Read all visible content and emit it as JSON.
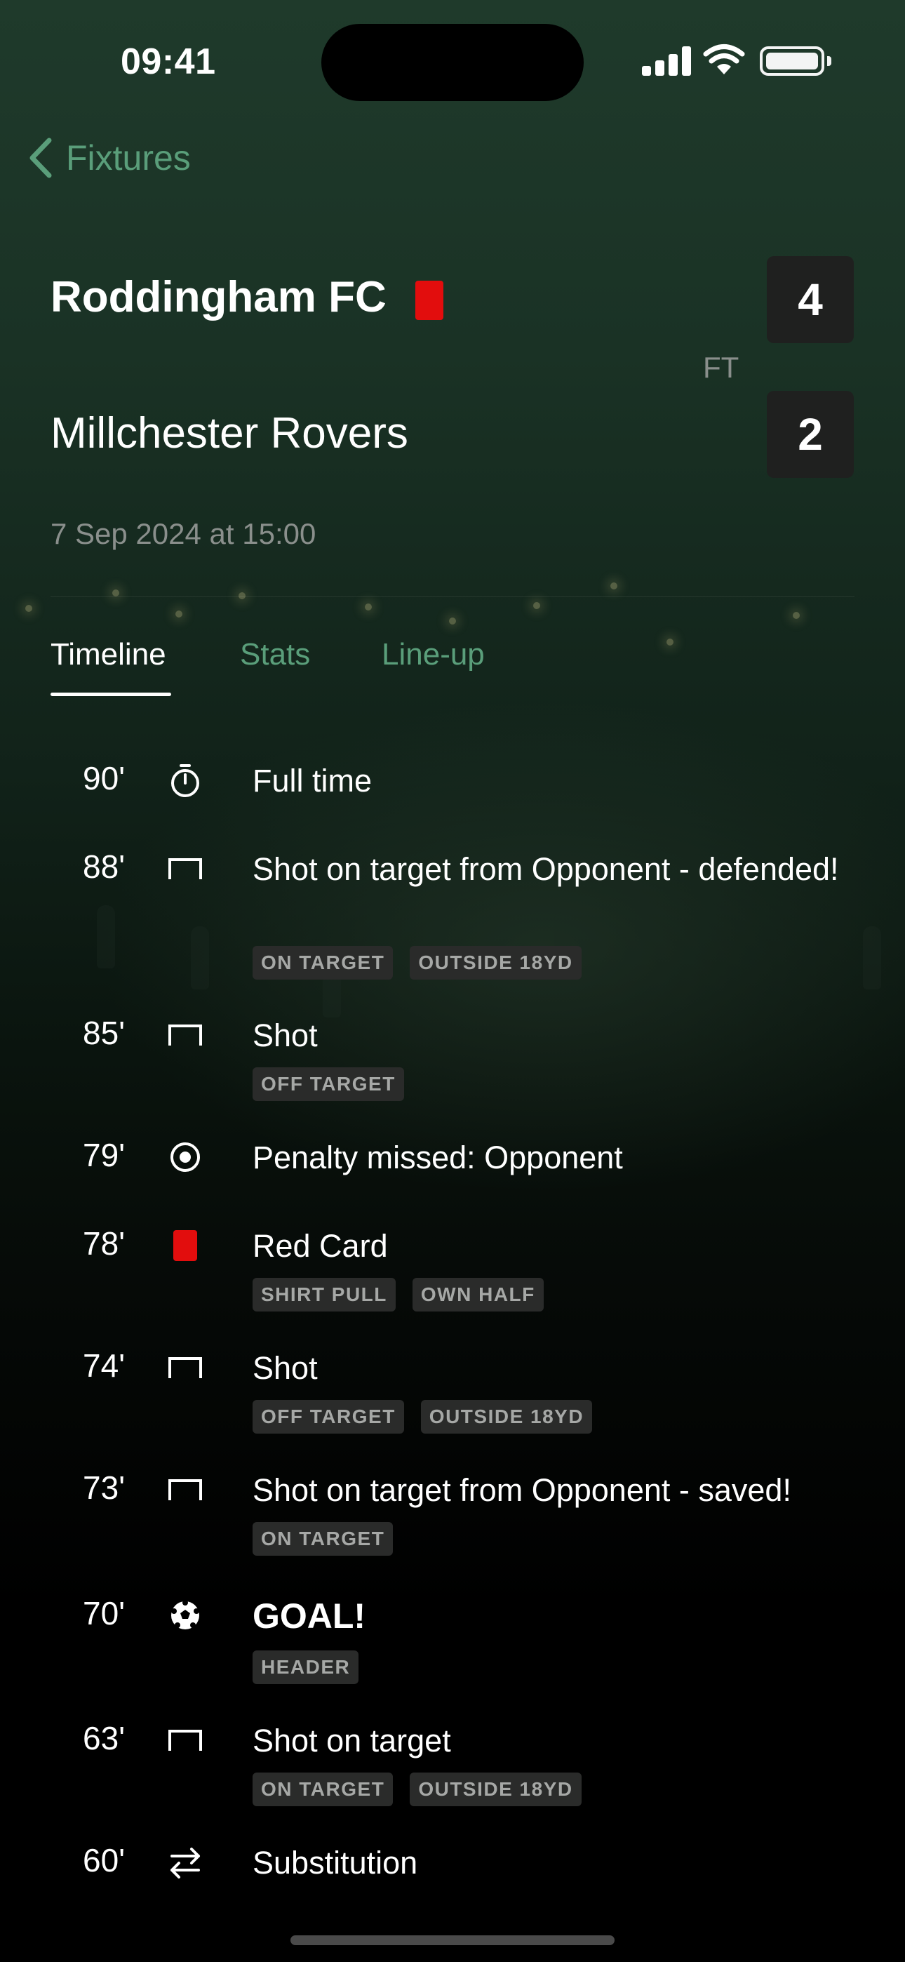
{
  "status_bar": {
    "time": "09:41"
  },
  "nav": {
    "back_label": "Fixtures"
  },
  "match": {
    "home_team": "Roddingham FC",
    "away_team": "Millchester Rovers",
    "home_score": "4",
    "away_score": "2",
    "status": "FT",
    "kickoff": "7 Sep 2024 at 15:00",
    "home_card_color": "#e20d0d"
  },
  "tabs": [
    {
      "label": "Timeline",
      "active": true
    },
    {
      "label": "Stats",
      "active": false
    },
    {
      "label": "Line-up",
      "active": false
    }
  ],
  "colors": {
    "accent": "#5a9e7a",
    "red_card": "#e20d0d",
    "tag_bg": "#2a2b2a"
  },
  "events": [
    {
      "minute": "90'",
      "icon": "stopwatch-icon",
      "text": "Full time",
      "tags": []
    },
    {
      "minute": "88'",
      "icon": "goalpost-icon",
      "text": "Shot on target from Opponent - defended!",
      "tags": [
        "ON TARGET",
        "OUTSIDE 18YD"
      ]
    },
    {
      "minute": "85'",
      "icon": "goalpost-icon",
      "text": "Shot",
      "tags": [
        "OFF TARGET"
      ]
    },
    {
      "minute": "79'",
      "icon": "target-icon",
      "text": "Penalty missed: Opponent",
      "tags": []
    },
    {
      "minute": "78'",
      "icon": "red-card-icon",
      "text": "Red Card",
      "tags": [
        "SHIRT PULL",
        "OWN HALF"
      ]
    },
    {
      "minute": "74'",
      "icon": "goalpost-icon",
      "text": "Shot",
      "tags": [
        "OFF TARGET",
        "OUTSIDE 18YD"
      ]
    },
    {
      "minute": "73'",
      "icon": "goalpost-icon",
      "text": "Shot on target from Opponent - saved!",
      "tags": [
        "ON TARGET"
      ]
    },
    {
      "minute": "70'",
      "icon": "football-icon",
      "text": "GOAL!",
      "tags": [
        "HEADER"
      ]
    },
    {
      "minute": "63'",
      "icon": "goalpost-icon",
      "text": "Shot on target",
      "tags": [
        "ON TARGET",
        "OUTSIDE 18YD"
      ]
    },
    {
      "minute": "60'",
      "icon": "substitution-icon",
      "text": "Substitution",
      "tags": []
    }
  ]
}
